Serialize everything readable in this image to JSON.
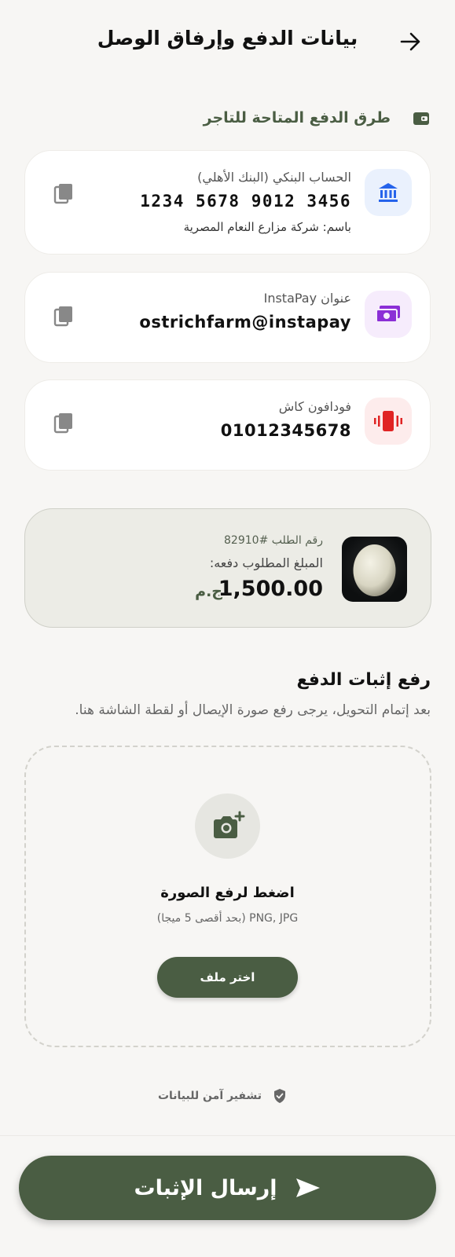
{
  "header": {
    "title": "بيانات الدفع وإرفاق الوصل"
  },
  "section": {
    "title": "طرق الدفع المتاحة للتاجر"
  },
  "payment_methods": [
    {
      "label": "الحساب البنكي (البنك الأهلي)",
      "value": "1234 5678 9012 3456",
      "sub": "باسم: شركة مزارع النعام المصرية",
      "icon": "bank-icon",
      "icon_color": "#2563eb",
      "icon_bg": "#eaf1fd"
    },
    {
      "label": "عنوان InstaPay",
      "value": "ostrichfarm@instapay",
      "icon": "money-icon",
      "icon_color": "#8b2fd6",
      "icon_bg": "#f6ecfc"
    },
    {
      "label": "فودافون كاش",
      "value": "01012345678",
      "icon": "phone-vibrate-icon",
      "icon_color": "#e02424",
      "icon_bg": "#fdecec"
    }
  ],
  "order": {
    "number": "رقم الطلب #82910",
    "due_label": "المبلغ المطلوب دفعه:",
    "amount": "1,500.00",
    "currency": "ج.م"
  },
  "upload": {
    "title": "رفع إثبات الدفع",
    "subtitle": "بعد إتمام التحويل، يرجى رفع صورة الإيصال أو لقطة الشاشة هنا.",
    "tap_label": "اضغط لرفع الصورة",
    "formats": "PNG, JPG (بحد أقصى 5 ميجا)",
    "choose_button": "اختر ملف"
  },
  "secure_note": "تشفير آمن للبيانات",
  "submit": {
    "label": "إرسال الإثبات"
  },
  "colors": {
    "accent": "#4a5d43",
    "background": "#f7f6f4"
  }
}
